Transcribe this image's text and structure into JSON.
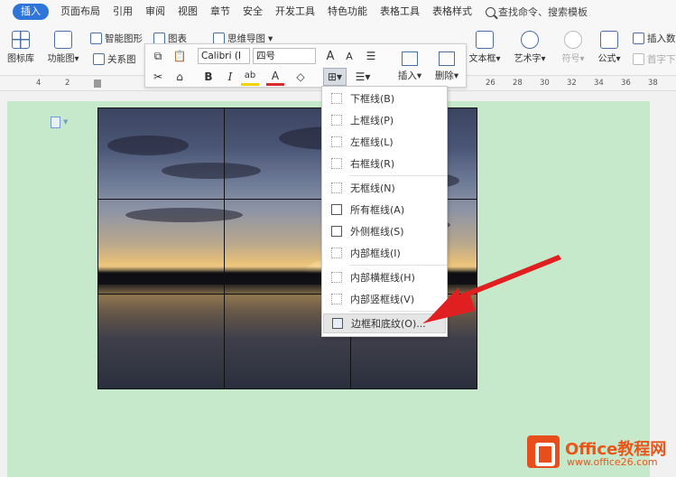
{
  "menubar": {
    "tabs": [
      "插入",
      "页面布局",
      "引用",
      "审阅",
      "视图",
      "章节",
      "安全",
      "开发工具",
      "特色功能",
      "表格工具",
      "表格样式"
    ],
    "active_tab": "插入",
    "search_text": "查找命令、搜索模板"
  },
  "ribbon": {
    "icon_library": "图标库",
    "function_chart": "功能图",
    "smart_shape": "智能图形",
    "chart": "图表",
    "mind_map": "思维导图",
    "relation_chart": "关系图",
    "insert_label": "插入",
    "delete_label": "删除",
    "text_box": "文本框",
    "art_text": "艺术字",
    "symbol": "符号",
    "formula": "公式",
    "insert_number": "插入数",
    "drop_cap": "首字下"
  },
  "mini_toolbar": {
    "font_name": "Calibri (I",
    "font_size": "四号",
    "bold": "B",
    "italic": "I",
    "highlight": "ab",
    "font_color": "A",
    "grow_font": "A",
    "shrink_font": "A"
  },
  "ruler": {
    "ticks": [
      "4",
      "2",
      "26",
      "28",
      "30",
      "32",
      "34",
      "36",
      "38"
    ]
  },
  "border_menu": {
    "items": [
      {
        "label": "下框线(B)"
      },
      {
        "label": "上框线(P)"
      },
      {
        "label": "左框线(L)"
      },
      {
        "label": "右框线(R)"
      },
      {
        "label": "无框线(N)"
      },
      {
        "label": "所有框线(A)"
      },
      {
        "label": "外侧框线(S)"
      },
      {
        "label": "内部框线(I)"
      },
      {
        "label": "内部横框线(H)"
      },
      {
        "label": "内部竖框线(V)"
      },
      {
        "label": "边框和底纹(O)..."
      }
    ]
  },
  "watermark": {
    "title": "Office教程网",
    "url": "www.office26.com"
  },
  "colors": {
    "page_bg": "#c7e9cb",
    "active_tab": "#2f74d8",
    "arrow": "#e02020",
    "watermark": "#e8561c"
  }
}
